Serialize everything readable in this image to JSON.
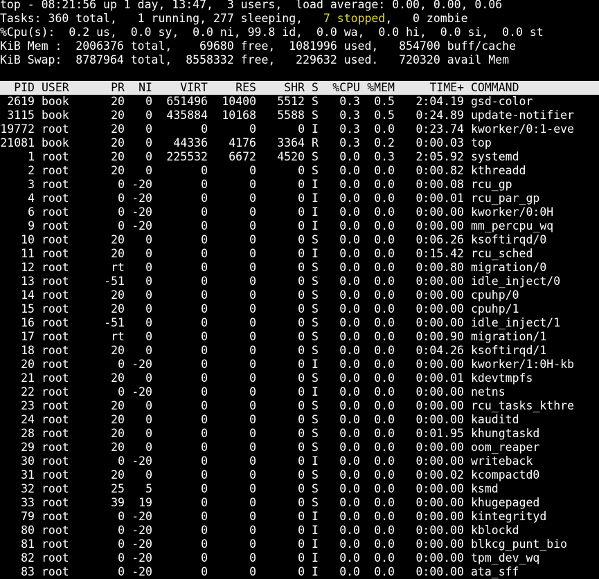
{
  "summary": {
    "top_line": "top - 08:21:56 up 1 day, 13:47,  3 users,  load average: 0.00, 0.00, 0.06",
    "tasks_prefix": "Tasks: 360 total,   1 running, 277 sleeping,   ",
    "tasks_stopped_count": "7",
    "tasks_stopped_label": "stopped",
    "tasks_suffix": ",   0 zombie",
    "cpu_line": "%Cpu(s):  0.2 us,  0.0 sy,  0.0 ni, 99.8 id,  0.0 wa,  0.0 hi,  0.0 si,  0.0 st",
    "mem_line": "KiB Mem :  2006376 total,    69680 free,  1081996 used,   854700 buff/cache",
    "swap_line": "KiB Swap:  8787964 total,  8558332 free,   229632 used.   720320 avail Mem"
  },
  "columns": [
    "PID",
    "USER",
    "PR",
    "NI",
    "VIRT",
    "RES",
    "SHR",
    "S",
    "%CPU",
    "%MEM",
    "TIME+",
    "COMMAND"
  ],
  "processes": [
    [
      "2619",
      "book",
      "20",
      "0",
      "651496",
      "10400",
      "5512",
      "S",
      "0.3",
      "0.5",
      "2:04.19",
      "gsd-color"
    ],
    [
      "3115",
      "book",
      "20",
      "0",
      "435884",
      "10168",
      "5588",
      "S",
      "0.3",
      "0.5",
      "0:24.89",
      "update-notifier"
    ],
    [
      "19772",
      "root",
      "20",
      "0",
      "0",
      "0",
      "0",
      "I",
      "0.3",
      "0.0",
      "0:23.74",
      "kworker/0:1-eve"
    ],
    [
      "21081",
      "book",
      "20",
      "0",
      "44336",
      "4176",
      "3364",
      "R",
      "0.3",
      "0.2",
      "0:00.03",
      "top"
    ],
    [
      "1",
      "root",
      "20",
      "0",
      "225532",
      "6672",
      "4520",
      "S",
      "0.0",
      "0.3",
      "2:05.92",
      "systemd"
    ],
    [
      "2",
      "root",
      "20",
      "0",
      "0",
      "0",
      "0",
      "S",
      "0.0",
      "0.0",
      "0:00.82",
      "kthreadd"
    ],
    [
      "3",
      "root",
      "0",
      "-20",
      "0",
      "0",
      "0",
      "I",
      "0.0",
      "0.0",
      "0:00.08",
      "rcu_gp"
    ],
    [
      "4",
      "root",
      "0",
      "-20",
      "0",
      "0",
      "0",
      "I",
      "0.0",
      "0.0",
      "0:00.01",
      "rcu_par_gp"
    ],
    [
      "6",
      "root",
      "0",
      "-20",
      "0",
      "0",
      "0",
      "I",
      "0.0",
      "0.0",
      "0:00.00",
      "kworker/0:0H"
    ],
    [
      "9",
      "root",
      "0",
      "-20",
      "0",
      "0",
      "0",
      "I",
      "0.0",
      "0.0",
      "0:00.00",
      "mm_percpu_wq"
    ],
    [
      "10",
      "root",
      "20",
      "0",
      "0",
      "0",
      "0",
      "S",
      "0.0",
      "0.0",
      "0:06.26",
      "ksoftirqd/0"
    ],
    [
      "11",
      "root",
      "20",
      "0",
      "0",
      "0",
      "0",
      "I",
      "0.0",
      "0.0",
      "0:15.42",
      "rcu_sched"
    ],
    [
      "12",
      "root",
      "rt",
      "0",
      "0",
      "0",
      "0",
      "S",
      "0.0",
      "0.0",
      "0:00.80",
      "migration/0"
    ],
    [
      "13",
      "root",
      "-51",
      "0",
      "0",
      "0",
      "0",
      "S",
      "0.0",
      "0.0",
      "0:00.00",
      "idle_inject/0"
    ],
    [
      "14",
      "root",
      "20",
      "0",
      "0",
      "0",
      "0",
      "S",
      "0.0",
      "0.0",
      "0:00.00",
      "cpuhp/0"
    ],
    [
      "15",
      "root",
      "20",
      "0",
      "0",
      "0",
      "0",
      "S",
      "0.0",
      "0.0",
      "0:00.00",
      "cpuhp/1"
    ],
    [
      "16",
      "root",
      "-51",
      "0",
      "0",
      "0",
      "0",
      "S",
      "0.0",
      "0.0",
      "0:00.00",
      "idle_inject/1"
    ],
    [
      "17",
      "root",
      "rt",
      "0",
      "0",
      "0",
      "0",
      "S",
      "0.0",
      "0.0",
      "0:00.90",
      "migration/1"
    ],
    [
      "18",
      "root",
      "20",
      "0",
      "0",
      "0",
      "0",
      "S",
      "0.0",
      "0.0",
      "0:04.26",
      "ksoftirqd/1"
    ],
    [
      "20",
      "root",
      "0",
      "-20",
      "0",
      "0",
      "0",
      "I",
      "0.0",
      "0.0",
      "0:00.00",
      "kworker/1:0H-kb"
    ],
    [
      "21",
      "root",
      "20",
      "0",
      "0",
      "0",
      "0",
      "S",
      "0.0",
      "0.0",
      "0:00.01",
      "kdevtmpfs"
    ],
    [
      "22",
      "root",
      "0",
      "-20",
      "0",
      "0",
      "0",
      "I",
      "0.0",
      "0.0",
      "0:00.00",
      "netns"
    ],
    [
      "23",
      "root",
      "20",
      "0",
      "0",
      "0",
      "0",
      "S",
      "0.0",
      "0.0",
      "0:00.00",
      "rcu_tasks_kthre"
    ],
    [
      "24",
      "root",
      "20",
      "0",
      "0",
      "0",
      "0",
      "S",
      "0.0",
      "0.0",
      "0:00.00",
      "kauditd"
    ],
    [
      "28",
      "root",
      "20",
      "0",
      "0",
      "0",
      "0",
      "S",
      "0.0",
      "0.0",
      "0:01.95",
      "khungtaskd"
    ],
    [
      "29",
      "root",
      "20",
      "0",
      "0",
      "0",
      "0",
      "S",
      "0.0",
      "0.0",
      "0:00.00",
      "oom_reaper"
    ],
    [
      "30",
      "root",
      "0",
      "-20",
      "0",
      "0",
      "0",
      "I",
      "0.0",
      "0.0",
      "0:00.00",
      "writeback"
    ],
    [
      "31",
      "root",
      "20",
      "0",
      "0",
      "0",
      "0",
      "S",
      "0.0",
      "0.0",
      "0:00.02",
      "kcompactd0"
    ],
    [
      "32",
      "root",
      "25",
      "5",
      "0",
      "0",
      "0",
      "S",
      "0.0",
      "0.0",
      "0:00.00",
      "ksmd"
    ],
    [
      "33",
      "root",
      "39",
      "19",
      "0",
      "0",
      "0",
      "S",
      "0.0",
      "0.0",
      "0:00.00",
      "khugepaged"
    ],
    [
      "79",
      "root",
      "0",
      "-20",
      "0",
      "0",
      "0",
      "I",
      "0.0",
      "0.0",
      "0:00.00",
      "kintegrityd"
    ],
    [
      "80",
      "root",
      "0",
      "-20",
      "0",
      "0",
      "0",
      "I",
      "0.0",
      "0.0",
      "0:00.00",
      "kblockd"
    ],
    [
      "81",
      "root",
      "0",
      "-20",
      "0",
      "0",
      "0",
      "I",
      "0.0",
      "0.0",
      "0:00.00",
      "blkcg_punt_bio"
    ],
    [
      "82",
      "root",
      "0",
      "-20",
      "0",
      "0",
      "0",
      "I",
      "0.0",
      "0.0",
      "0:00.00",
      "tpm_dev_wq"
    ],
    [
      "83",
      "root",
      "0",
      "-20",
      "0",
      "0",
      "0",
      "I",
      "0.0",
      "0.0",
      "0:00.00",
      "ata_sff"
    ]
  ]
}
